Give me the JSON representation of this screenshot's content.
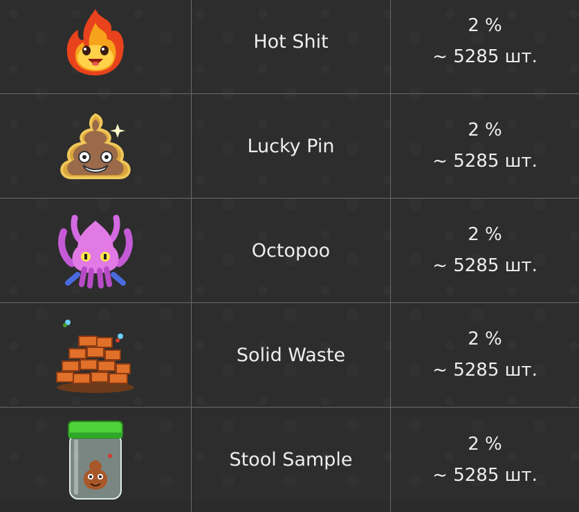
{
  "rows": [
    {
      "icon": "fire-blob-icon",
      "name": "Hot Shit",
      "percent": "2 %",
      "amount": "~ 5285 шт."
    },
    {
      "icon": "glitter-poop-icon",
      "name": "Lucky Pin",
      "percent": "2 %",
      "amount": "~ 5285 шт."
    },
    {
      "icon": "octopus-icon",
      "name": "Octopoo",
      "percent": "2 %",
      "amount": "~ 5285 шт."
    },
    {
      "icon": "brick-pile-icon",
      "name": "Solid Waste",
      "percent": "2 %",
      "amount": "~ 5285 шт."
    },
    {
      "icon": "jar-icon",
      "name": "Stool Sample",
      "percent": "2 %",
      "amount": "~ 5285 шт."
    }
  ]
}
